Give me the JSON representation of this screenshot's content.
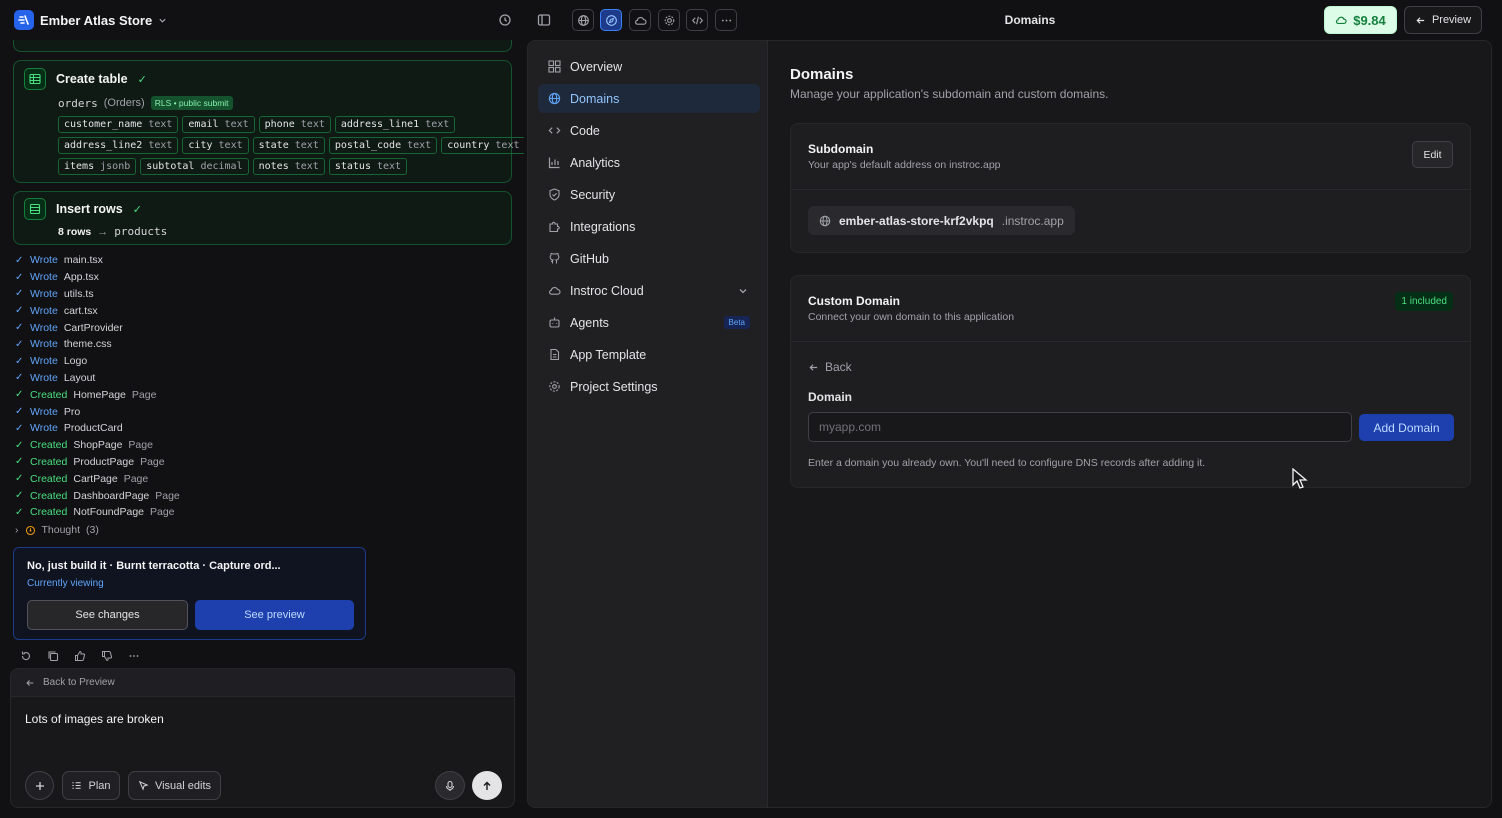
{
  "app": {
    "name": "Ember Atlas Store",
    "page_title": "Domains",
    "credits": "$9.84",
    "preview_label": "Preview"
  },
  "chat": {
    "create_table": {
      "title": "Create table",
      "table_name": "orders",
      "table_alias": "(Orders)",
      "badge": "RLS • public submit",
      "columns": [
        [
          {
            "name": "customer_name",
            "type": "text"
          },
          {
            "name": "email",
            "type": "text"
          },
          {
            "name": "phone",
            "type": "text"
          },
          {
            "name": "address_line1",
            "type": "text"
          }
        ],
        [
          {
            "name": "address_line2",
            "type": "text"
          },
          {
            "name": "city",
            "type": "text"
          },
          {
            "name": "state",
            "type": "text"
          },
          {
            "name": "postal_code",
            "type": "text"
          },
          {
            "name": "country",
            "type": "text"
          }
        ],
        [
          {
            "name": "items",
            "type": "jsonb"
          },
          {
            "name": "subtotal",
            "type": "decimal"
          },
          {
            "name": "notes",
            "type": "text"
          },
          {
            "name": "status",
            "type": "text"
          }
        ]
      ]
    },
    "insert_rows": {
      "title": "Insert rows",
      "count": "8 rows",
      "arrow": "→",
      "target": "products"
    },
    "log": [
      {
        "verb": "Wrote",
        "file": "main.tsx",
        "suffix": ""
      },
      {
        "verb": "Wrote",
        "file": "App.tsx",
        "suffix": ""
      },
      {
        "verb": "Wrote",
        "file": "utils.ts",
        "suffix": ""
      },
      {
        "verb": "Wrote",
        "file": "cart.tsx",
        "suffix": ""
      },
      {
        "verb": "Wrote",
        "file": "CartProvider",
        "suffix": ""
      },
      {
        "verb": "Wrote",
        "file": "theme.css",
        "suffix": ""
      },
      {
        "verb": "Wrote",
        "file": "Logo",
        "suffix": ""
      },
      {
        "verb": "Wrote",
        "file": "Layout",
        "suffix": ""
      },
      {
        "verb": "Created",
        "file": "HomePage",
        "suffix": "Page"
      },
      {
        "verb": "Wrote",
        "file": "Pro",
        "suffix": ""
      },
      {
        "verb": "Wrote",
        "file": "ProductCard",
        "suffix": ""
      },
      {
        "verb": "Created",
        "file": "ShopPage",
        "suffix": "Page"
      },
      {
        "verb": "Created",
        "file": "ProductPage",
        "suffix": "Page"
      },
      {
        "verb": "Created",
        "file": "CartPage",
        "suffix": "Page"
      },
      {
        "verb": "Created",
        "file": "DashboardPage",
        "suffix": "Page"
      },
      {
        "verb": "Created",
        "file": "NotFoundPage",
        "suffix": "Page"
      }
    ],
    "thought_label": "Thought",
    "thought_count": "(3)",
    "version_card": {
      "title": "No, just build it · Burnt terracotta · Capture ord...",
      "status": "Currently viewing",
      "see_changes": "See changes",
      "see_preview": "See preview"
    },
    "composer": {
      "back_label": "Back to Preview",
      "text": "Lots of images are broken",
      "plan_label": "Plan",
      "visual_edits_label": "Visual edits"
    }
  },
  "nav": {
    "items": [
      {
        "label": "Overview",
        "icon": "overview-icon"
      },
      {
        "label": "Domains",
        "icon": "globe-icon"
      },
      {
        "label": "Code",
        "icon": "code-icon"
      },
      {
        "label": "Analytics",
        "icon": "analytics-icon"
      },
      {
        "label": "Security",
        "icon": "shield-icon"
      },
      {
        "label": "Integrations",
        "icon": "puzzle-icon"
      },
      {
        "label": "GitHub",
        "icon": "github-icon"
      },
      {
        "label": "Instroc Cloud",
        "icon": "cloud-icon"
      },
      {
        "label": "Agents",
        "icon": "agent-icon",
        "badge": "Beta"
      },
      {
        "label": "App Template",
        "icon": "template-icon"
      },
      {
        "label": "Project Settings",
        "icon": "settings-icon"
      }
    ],
    "active": "Domains"
  },
  "domains": {
    "title": "Domains",
    "subtitle": "Manage your application's subdomain and custom domains.",
    "subdomain": {
      "title": "Subdomain",
      "subtitle": "Your app's default address on instroc.app",
      "edit_label": "Edit",
      "value": "ember-atlas-store-krf2vkpq",
      "suffix": ".instroc.app"
    },
    "custom": {
      "title": "Custom Domain",
      "subtitle": "Connect your own domain to this application",
      "badge": "1 included",
      "back_label": "Back",
      "field_label": "Domain",
      "placeholder": "myapp.com",
      "value": "",
      "add_label": "Add Domain",
      "help": "Enter a domain you already own. You'll need to configure DNS records after adding it."
    }
  },
  "colors": {
    "accent": "#2563eb",
    "success": "#4ade80",
    "background": "#111113"
  }
}
